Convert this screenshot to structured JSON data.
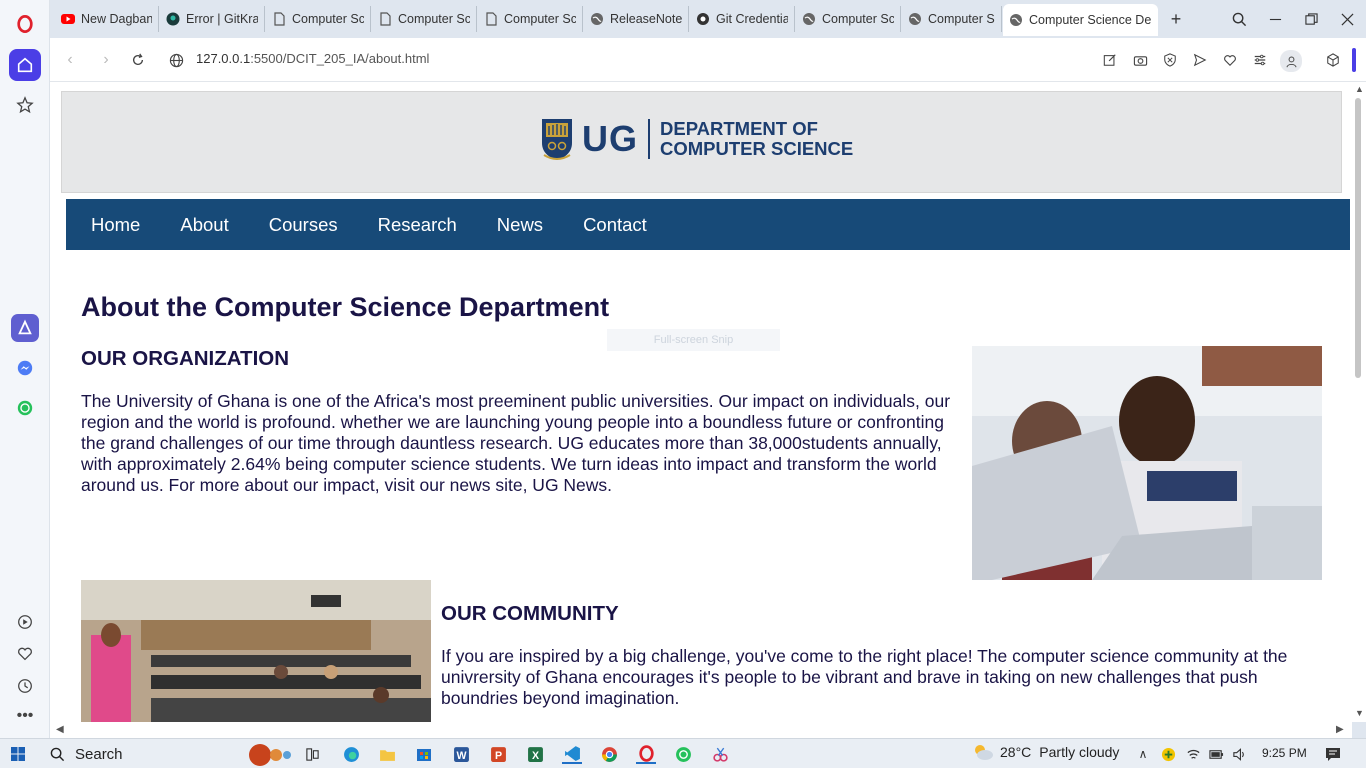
{
  "browser": {
    "tabs": [
      {
        "label": "New Dagbani",
        "icon": "youtube-icon"
      },
      {
        "label": "Error | GitKrak",
        "icon": "gitkraken-icon"
      },
      {
        "label": "Computer Scie",
        "icon": "document-icon"
      },
      {
        "label": "Computer Scie",
        "icon": "document-icon"
      },
      {
        "label": "Computer Scie",
        "icon": "document-icon"
      },
      {
        "label": "ReleaseNotes.",
        "icon": "globe-icon"
      },
      {
        "label": "Git Credential",
        "icon": "github-icon"
      },
      {
        "label": "Computer Scie",
        "icon": "globe-icon"
      },
      {
        "label": "Computer Scie",
        "icon": "globe-icon"
      },
      {
        "label": "Computer Science Depa",
        "icon": "globe-icon",
        "active": true
      }
    ],
    "url_host": "127.0.0.1",
    "url_path": ":5500/DCIT_205_IA/about.html"
  },
  "site": {
    "logo_text": "UG",
    "dept_line1": "DEPARTMENT OF",
    "dept_line2": "COMPUTER SCIENCE",
    "nav": [
      "Home",
      "About",
      "Courses",
      "Research",
      "News",
      "Contact"
    ],
    "page_title": "About the Computer Science Department",
    "snip_overlay": "Full-screen Snip",
    "org_heading": "OUR ORGANIZATION",
    "org_text": "The University of Ghana is one of the Africa's most preeminent public universities. Our impact on individuals, our region and the world is profound. whether we are launching young people into a boundless future or confronting the grand challenges of our time through dauntless research. UG educates more than 38,000students annually, with approximately 2.64% being computer science students. We turn ideas into impact and transform the world around us. For more about our impact, visit our news site, UG News.",
    "community_heading": "OUR COMMUNITY",
    "community_text": "If you are inspired by a big challenge, you've come to the right place! The computer science community at the univrersity of Ghana encourages it's people to be vibrant and brave in taking on new challenges that push boundries beyond imagination."
  },
  "taskbar": {
    "search_label": "Search",
    "temperature": "28°C",
    "weather": "Partly cloudy",
    "time": "9:25 PM"
  },
  "colors": {
    "nav_bg": "#174a78",
    "heading": "#1a1446",
    "brand": "#1d3e70"
  }
}
